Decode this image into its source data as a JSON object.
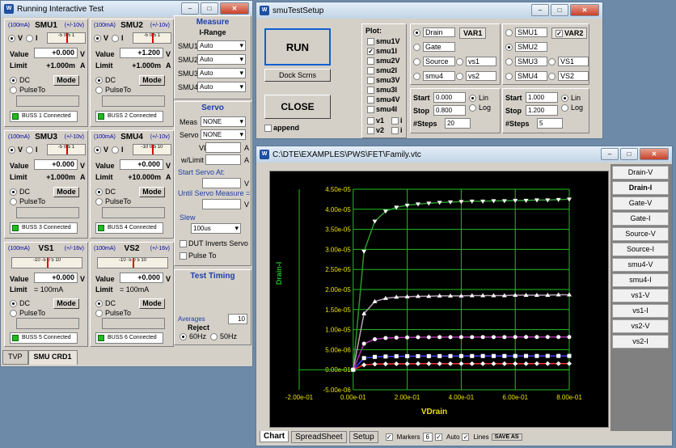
{
  "win1": {
    "title": "Running Interactive Test"
  },
  "smus": [
    {
      "name": "SMU1",
      "range_i": "(100mA)",
      "range_v": "(+/-10v)",
      "mode_v": "V",
      "mode_i": "I",
      "value": "+0.000",
      "value_unit": "V",
      "limit": "+1.000m",
      "limit_unit": "A",
      "buss": "BUSS 1 Connected",
      "scale": "-5  0  5  1"
    },
    {
      "name": "SMU2",
      "range_i": "(100mA)",
      "range_v": "(+/-10v)",
      "mode_v": "V",
      "mode_i": "I",
      "value": "+1.200",
      "value_unit": "V",
      "limit": "+1.000m",
      "limit_unit": "A",
      "buss": "BUSS 2 Connected",
      "scale": "-5  0  5  1"
    },
    {
      "name": "SMU3",
      "range_i": "(100mA)",
      "range_v": "(+/-10v)",
      "mode_v": "V",
      "mode_i": "I",
      "value": "+0.000",
      "value_unit": "V",
      "limit": "+1.000m",
      "limit_unit": "A",
      "buss": "BUSS 3 Connected",
      "scale": "-5  0  5  1"
    },
    {
      "name": "SMU4",
      "range_i": "(100mA)",
      "range_v": "(+/-10v)",
      "mode_v": "V",
      "mode_i": "I",
      "value": "+0.000",
      "value_unit": "V",
      "limit": "+10.000m",
      "limit_unit": "A",
      "buss": "BUSS 4 Connected",
      "scale": "-10 0  5 10"
    }
  ],
  "vs": [
    {
      "name": "VS1",
      "range_i": "(100mA)",
      "range_v": "(+/-16v)",
      "value": "+0.000",
      "value_unit": "V",
      "limit": "= 100mA",
      "buss": "BUSS 5 Connected",
      "scale": "-10 -5  0  5 10"
    },
    {
      "name": "VS2",
      "range_i": "(100mA)",
      "range_v": "(+/-16v)",
      "value": "+0.000",
      "value_unit": "V",
      "limit": "= 100mA",
      "buss": "BUSS 6 Connected",
      "scale": "-10 -5  0  5 10"
    }
  ],
  "labels": {
    "value": "Value",
    "limit": "Limit",
    "dc": "DC",
    "pulse": "PulseTo",
    "mode": "Mode"
  },
  "measure": {
    "title": "Measure",
    "subtitle": "I-Range",
    "rows": [
      {
        "label": "SMU1",
        "value": "Auto"
      },
      {
        "label": "SMU2",
        "value": "Auto"
      },
      {
        "label": "SMU3",
        "value": "Auto"
      },
      {
        "label": "SMU4",
        "value": "Auto"
      }
    ]
  },
  "servo": {
    "title": "Servo",
    "meas_label": "Meas",
    "meas_value": "NONE",
    "servo_label": "Servo",
    "servo_value": "NONE",
    "vlim_label": "VLim",
    "vlim_unit": "A",
    "wlimit_label": "w/Limit",
    "wlimit_unit": "A",
    "start_label": "Start Servo At:",
    "start_unit": "V",
    "until_label": "Until Servo Measure =",
    "until_unit": "V",
    "slew_label": "Slew",
    "slew_value": "100us",
    "dut_label": "DUT Inverts Servo",
    "pulse_label": "Pulse To"
  },
  "timing": {
    "title": "Test Timing",
    "averages_label": "Averages",
    "averages_value": "10",
    "reject_label": "Reject",
    "hz60": "60Hz",
    "hz50": "50Hz"
  },
  "tabs1": [
    {
      "label": "TVP"
    },
    {
      "label": "SMU CRD1"
    }
  ],
  "win2": {
    "title": "smuTestSetup",
    "run": "RUN",
    "dock": "Dock Scrns",
    "close": "CLOSE",
    "append": "append",
    "plot_label": "Plot:",
    "plot_items": [
      "smu1V",
      "smu1I",
      "smu2V",
      "smu2I",
      "smu3V",
      "smu3I",
      "smu4V",
      "smu4I"
    ],
    "plot_v": "v1",
    "plot_i": "i",
    "plot_v2": "v2",
    "plot_i2": "i",
    "var1_nodes": [
      {
        "label": "Drain",
        "selected": true
      },
      {
        "label": "Gate"
      },
      {
        "label": "Source"
      },
      {
        "label": "smu4"
      }
    ],
    "var1_vs": [
      "vs1",
      "vs2"
    ],
    "var1_label": "VAR1",
    "var2_nodes": [
      {
        "label": "SMU1"
      },
      {
        "label": "SMU2",
        "selected": true
      },
      {
        "label": "SMU3"
      },
      {
        "label": "SMU4"
      }
    ],
    "var2_vs": [
      "VS1",
      "VS2"
    ],
    "var2_label": "VAR2",
    "var1_sweep": {
      "start": "0.000",
      "stop": "0.800",
      "steps": "20"
    },
    "var2_sweep": {
      "start": "1.000",
      "stop": "1.200",
      "steps": "5"
    },
    "start_label": "Start",
    "stop_label": "Stop",
    "steps_label": "#Steps",
    "lin": "Lin",
    "log": "Log"
  },
  "win3": {
    "title": "C:\\DTE\\EXAMPLES\\PWS\\FET\\Family.vtc",
    "tabs": [
      "Chart",
      "SpreadSheet",
      "Setup"
    ],
    "markers_label": "Markers",
    "markers_value": "6",
    "auto_label": "Auto",
    "lines_label": "Lines",
    "save_label": "SAVE AS",
    "side": [
      "Drain-V",
      "Drain-I",
      "Gate-V",
      "Gate-I",
      "Source-V",
      "Source-I",
      "smu4-V",
      "smu4-I",
      "vs1-V",
      "vs1-I",
      "vs2-V",
      "vs2-I"
    ]
  },
  "chart_data": {
    "type": "line",
    "xlabel": "VDrain",
    "ylabel": "Drain-I",
    "xlim": [
      -0.2,
      0.8
    ],
    "ylim": [
      -5e-06,
      4.5e-05
    ],
    "xticks": [
      "-2.00e-01",
      "0.00e-01",
      "2.00e-01",
      "4.00e-01",
      "6.00e-01",
      "8.00e-01"
    ],
    "yticks": [
      "4.50e-05",
      "4.00e-05",
      "3.50e-05",
      "3.00e-05",
      "2.50e-05",
      "2.00e-05",
      "1.50e-05",
      "1.00e-05",
      "5.00e-06",
      "0.00e-01",
      "-5.00e-06"
    ],
    "x": [
      0,
      0.04,
      0.08,
      0.12,
      0.16,
      0.2,
      0.24,
      0.28,
      0.32,
      0.36,
      0.4,
      0.44,
      0.48,
      0.52,
      0.56,
      0.6,
      0.64,
      0.68,
      0.72,
      0.76,
      0.8
    ],
    "series": [
      {
        "color": "#ffffff",
        "marker": "tri-down",
        "values": [
          0,
          2.95e-05,
          3.7e-05,
          3.95e-05,
          4.05e-05,
          4.1e-05,
          4.13e-05,
          4.15e-05,
          4.17e-05,
          4.18e-05,
          4.19e-05,
          4.2e-05,
          4.2e-05,
          4.21e-05,
          4.21e-05,
          4.22e-05,
          4.22e-05,
          4.23e-05,
          4.23e-05,
          4.24e-05,
          4.25e-05
        ],
        "line": "#2a9a2a"
      },
      {
        "color": "#ffffff",
        "marker": "tri-up",
        "values": [
          0,
          1.4e-05,
          1.7e-05,
          1.78e-05,
          1.81e-05,
          1.82e-05,
          1.83e-05,
          1.83e-05,
          1.84e-05,
          1.84e-05,
          1.84e-05,
          1.85e-05,
          1.85e-05,
          1.85e-05,
          1.85e-05,
          1.86e-05,
          1.86e-05,
          1.86e-05,
          1.86e-05,
          1.87e-05,
          1.87e-05
        ],
        "line": "#b8a0b8"
      },
      {
        "color": "#ffffff",
        "marker": "circle",
        "values": [
          0,
          6.5e-06,
          7.6e-06,
          7.9e-06,
          8e-06,
          8.05e-06,
          8.1e-06,
          8.1e-06,
          8.12e-06,
          8.12e-06,
          8.13e-06,
          8.13e-06,
          8.14e-06,
          8.14e-06,
          8.14e-06,
          8.15e-06,
          8.15e-06,
          8.15e-06,
          8.16e-06,
          8.16e-06,
          8.16e-06
        ],
        "line": "#b030b0"
      },
      {
        "color": "#ffffff",
        "marker": "square",
        "values": [
          0,
          2.9e-06,
          3.2e-06,
          3.3e-06,
          3.35e-06,
          3.37e-06,
          3.38e-06,
          3.39e-06,
          3.4e-06,
          3.4e-06,
          3.41e-06,
          3.41e-06,
          3.42e-06,
          3.42e-06,
          3.42e-06,
          3.43e-06,
          3.43e-06,
          3.43e-06,
          3.44e-06,
          3.44e-06,
          3.44e-06
        ],
        "line": "#4040ff"
      },
      {
        "color": "#ffffff",
        "marker": "diamond",
        "values": [
          0,
          1.2e-06,
          1.4e-06,
          1.45e-06,
          1.47e-06,
          1.48e-06,
          1.49e-06,
          1.49e-06,
          1.5e-06,
          1.5e-06,
          1.5e-06,
          1.5e-06,
          1.51e-06,
          1.51e-06,
          1.51e-06,
          1.51e-06,
          1.51e-06,
          1.52e-06,
          1.52e-06,
          1.52e-06,
          1.52e-06
        ],
        "line": "#ff3030"
      }
    ],
    "grid": true
  }
}
